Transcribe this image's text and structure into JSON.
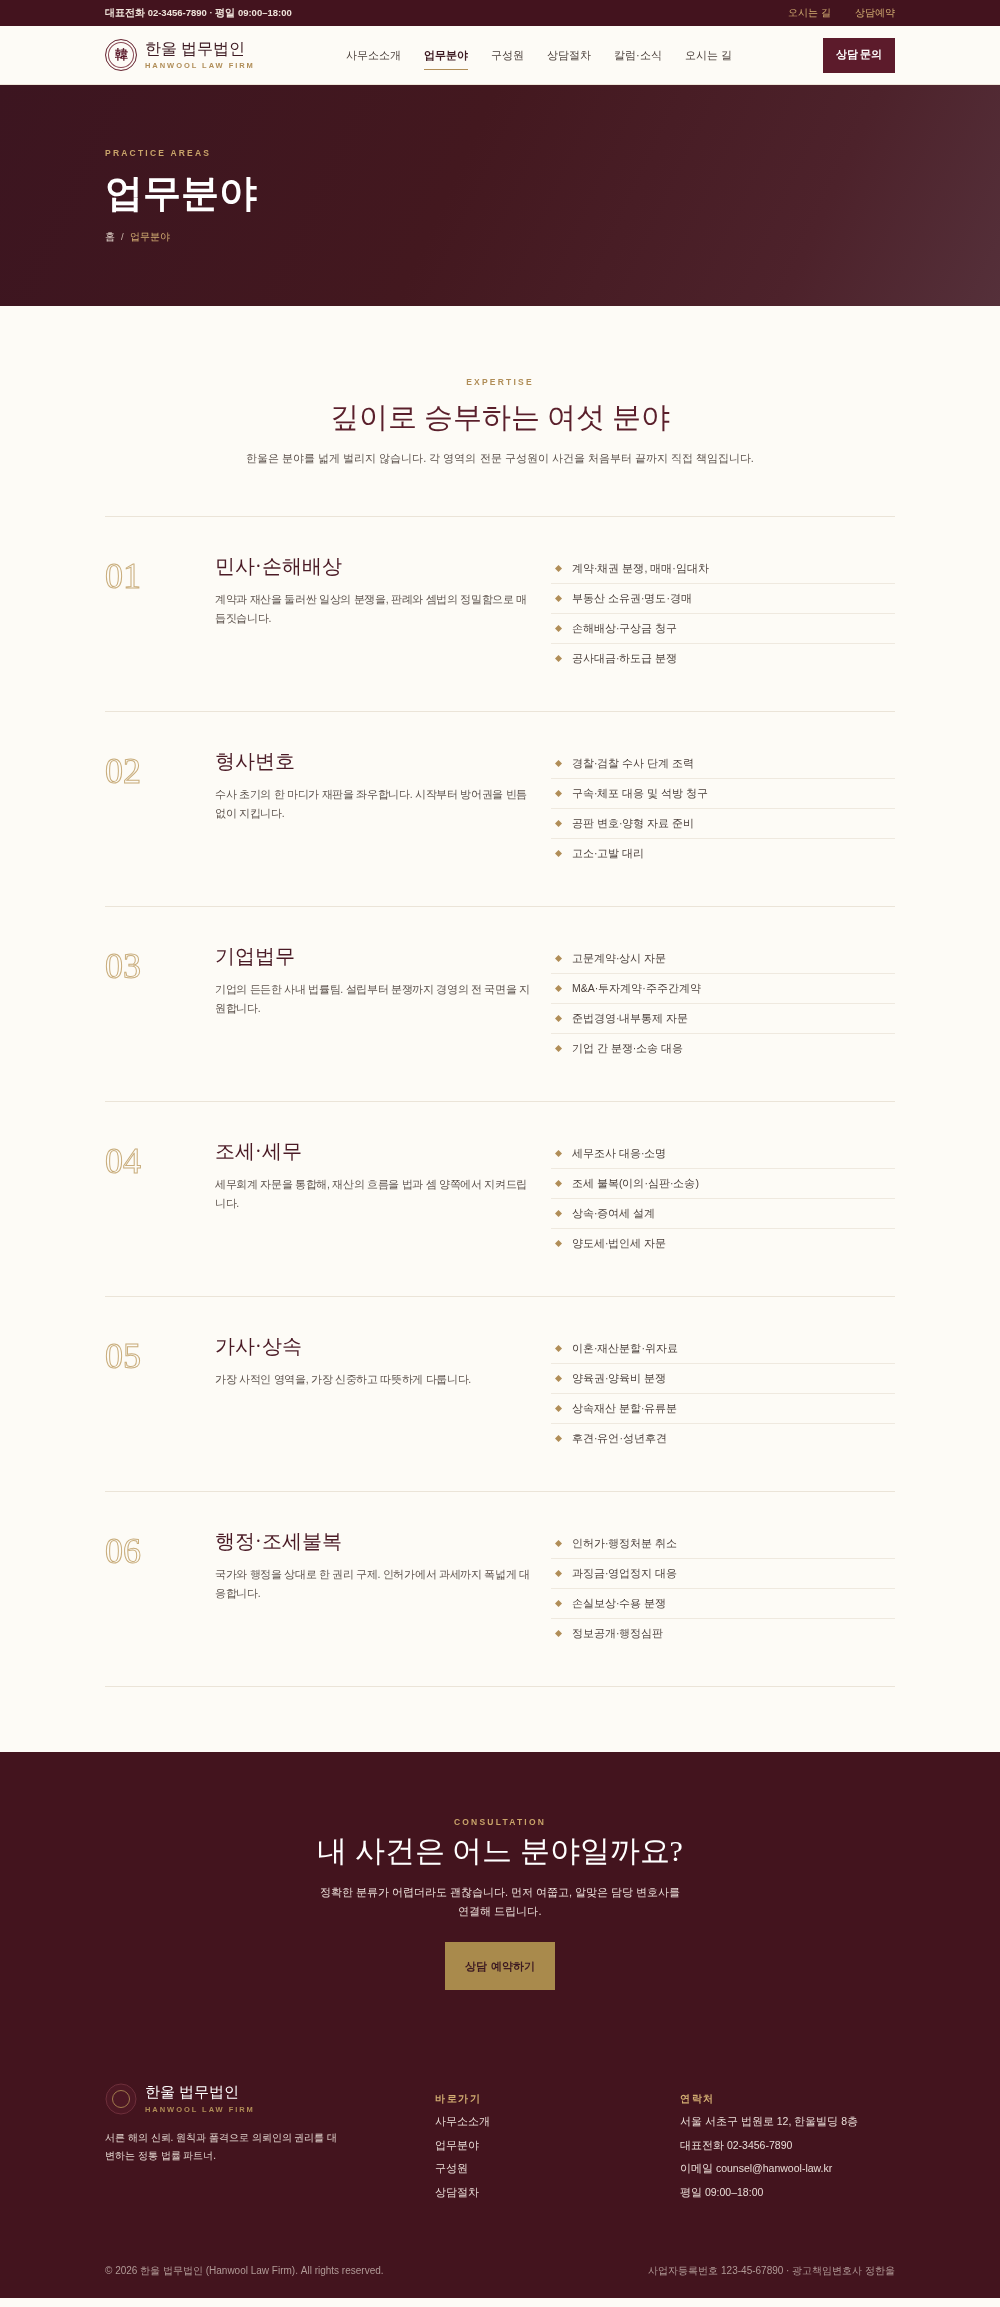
{
  "top_bar": {
    "contact": "대표전화 02-3456-7890 · 평일 09:00–18:00",
    "links": [
      "오시는 길",
      "상담예약"
    ]
  },
  "navbar": {
    "logo": {
      "mark": "韓",
      "name": "한울 법무법인",
      "subtitle": "HANWOOL LAW FIRM"
    },
    "items": [
      {
        "label": "사무소소개",
        "selected": false
      },
      {
        "label": "업무분야",
        "selected": true
      },
      {
        "label": "구성원",
        "selected": false
      },
      {
        "label": "상담절차",
        "selected": false
      },
      {
        "label": "칼럼·소식",
        "selected": false
      },
      {
        "label": "오시는 길",
        "selected": false
      }
    ],
    "cta_button": "상담 문의"
  },
  "hero": {
    "eyebrow": "PRACTICE AREAS",
    "title": "업무분야",
    "breadcrumb": {
      "separator": "/",
      "items": [
        {
          "label": "홈",
          "selected": false
        },
        {
          "label": "업무분야",
          "selected": true
        }
      ]
    }
  },
  "expertise": {
    "eyebrow": "EXPERTISE",
    "title": "깊이로 승부하는 여섯 분야",
    "intro": "한울은 분야를 넓게 벌리지 않습니다. 각 영역의 전문 구성원이 사건을 처음부터 끝까지 직접 책임집니다."
  },
  "practice_areas": [
    {
      "number": "01",
      "title": "민사·손해배상",
      "description": "계약과 재산을 둘러싼 일상의 분쟁을, 판례와 셈법의 정밀함으로 매듭짓습니다.",
      "services": [
        "계약·채권 분쟁, 매매·임대차",
        "부동산 소유권·명도·경매",
        "손해배상·구상금 청구",
        "공사대금·하도급 분쟁"
      ]
    },
    {
      "number": "02",
      "title": "형사변호",
      "description": "수사 초기의 한 마디가 재판을 좌우합니다. 시작부터 방어권을 빈틈없이 지킵니다.",
      "services": [
        "경찰·검찰 수사 단계 조력",
        "구속·체포 대응 및 석방 청구",
        "공판 변호·양형 자료 준비",
        "고소·고발 대리"
      ]
    },
    {
      "number": "03",
      "title": "기업법무",
      "description": "기업의 든든한 사내 법률팀. 설립부터 분쟁까지 경영의 전 국면을 지원합니다.",
      "services": [
        "고문계약·상시 자문",
        "M&A·투자계약·주주간계약",
        "준법경영·내부통제 자문",
        "기업 간 분쟁·소송 대응"
      ]
    },
    {
      "number": "04",
      "title": "조세·세무",
      "description": "세무회계 자문을 통합해, 재산의 흐름을 법과 셈 양쪽에서 지켜드립니다.",
      "services": [
        "세무조사 대응·소명",
        "조세 불복(이의·심판·소송)",
        "상속·증여세 설계",
        "양도세·법인세 자문"
      ]
    },
    {
      "number": "05",
      "title": "가사·상속",
      "description": "가장 사적인 영역을, 가장 신중하고 따뜻하게 다룹니다.",
      "services": [
        "이혼·재산분할·위자료",
        "양육권·양육비 분쟁",
        "상속재산 분할·유류분",
        "후견·유언·성년후견"
      ]
    },
    {
      "number": "06",
      "title": "행정·조세불복",
      "description": "국가와 행정을 상대로 한 권리 구제. 인허가에서 과세까지 폭넓게 대응합니다.",
      "services": [
        "인허가·행정처분 취소",
        "과징금·영업정지 대응",
        "손실보상·수용 분쟁",
        "정보공개·행정심판"
      ]
    }
  ],
  "consultation": {
    "eyebrow": "CONSULTATION",
    "title": "내 사건은 어느 분야일까요?",
    "text": "정확한 분류가 어렵더라도 괜찮습니다. 먼저 여쭙고, 알맞은 담당 변호사를 연결해 드립니다.",
    "button": "상담 예약하기"
  },
  "footer": {
    "brand": {
      "name": "한울 법무법인",
      "subtitle": "HANWOOL LAW FIRM",
      "tagline": "서른 해의 신뢰. 원칙과 품격으로 의뢰인의 권리를 대변하는 정통 법률 파트너."
    },
    "quick_links": {
      "heading": "바로가기",
      "links": [
        "사무소소개",
        "업무분야",
        "구성원",
        "상담절차"
      ]
    },
    "contact": {
      "heading": "연락처",
      "lines": [
        "서울 서초구 법원로 12, 한울빌딩 8층",
        "대표전화 02-3456-7890",
        "이메일 counsel@hanwool-law.kr",
        "평일 09:00–18:00"
      ]
    },
    "copyright": "© 2026 한울 법무법인 (Hanwool Law Firm). All rights reserved.",
    "registration": "사업자등록번호 123-45-67890 · 광고책임변호사 정한울"
  }
}
